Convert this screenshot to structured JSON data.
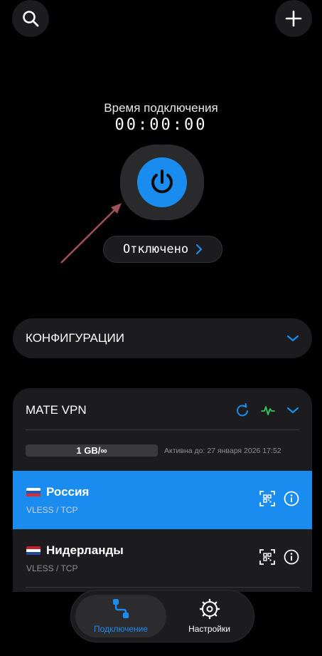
{
  "header": {
    "search_icon": "search-icon",
    "add_icon": "plus-icon"
  },
  "connection": {
    "timer_label": "Время подключения",
    "timer": "00:00:00",
    "status": "Отключено",
    "power_color": "#1a8cf0"
  },
  "configs": {
    "label": "КОНФИГУРАЦИИ"
  },
  "subscription": {
    "title": "MATE VPN",
    "traffic": "1 GB/∞",
    "expiry": "Активна до: 27 января 2026 17:52"
  },
  "servers": [
    {
      "name": "Россия",
      "protocol": "VLESS / TCP",
      "active": true
    },
    {
      "name": "Нидерланды",
      "protocol": "VLESS / TCP",
      "active": false
    }
  ],
  "tabs": [
    {
      "label": "Подключение",
      "active": true
    },
    {
      "label": "Настройки",
      "active": false
    }
  ],
  "colors": {
    "accent": "#1a8cf0",
    "panel": "#1c1c1e",
    "ping": "#34c759",
    "arrow": "#a0505a"
  }
}
